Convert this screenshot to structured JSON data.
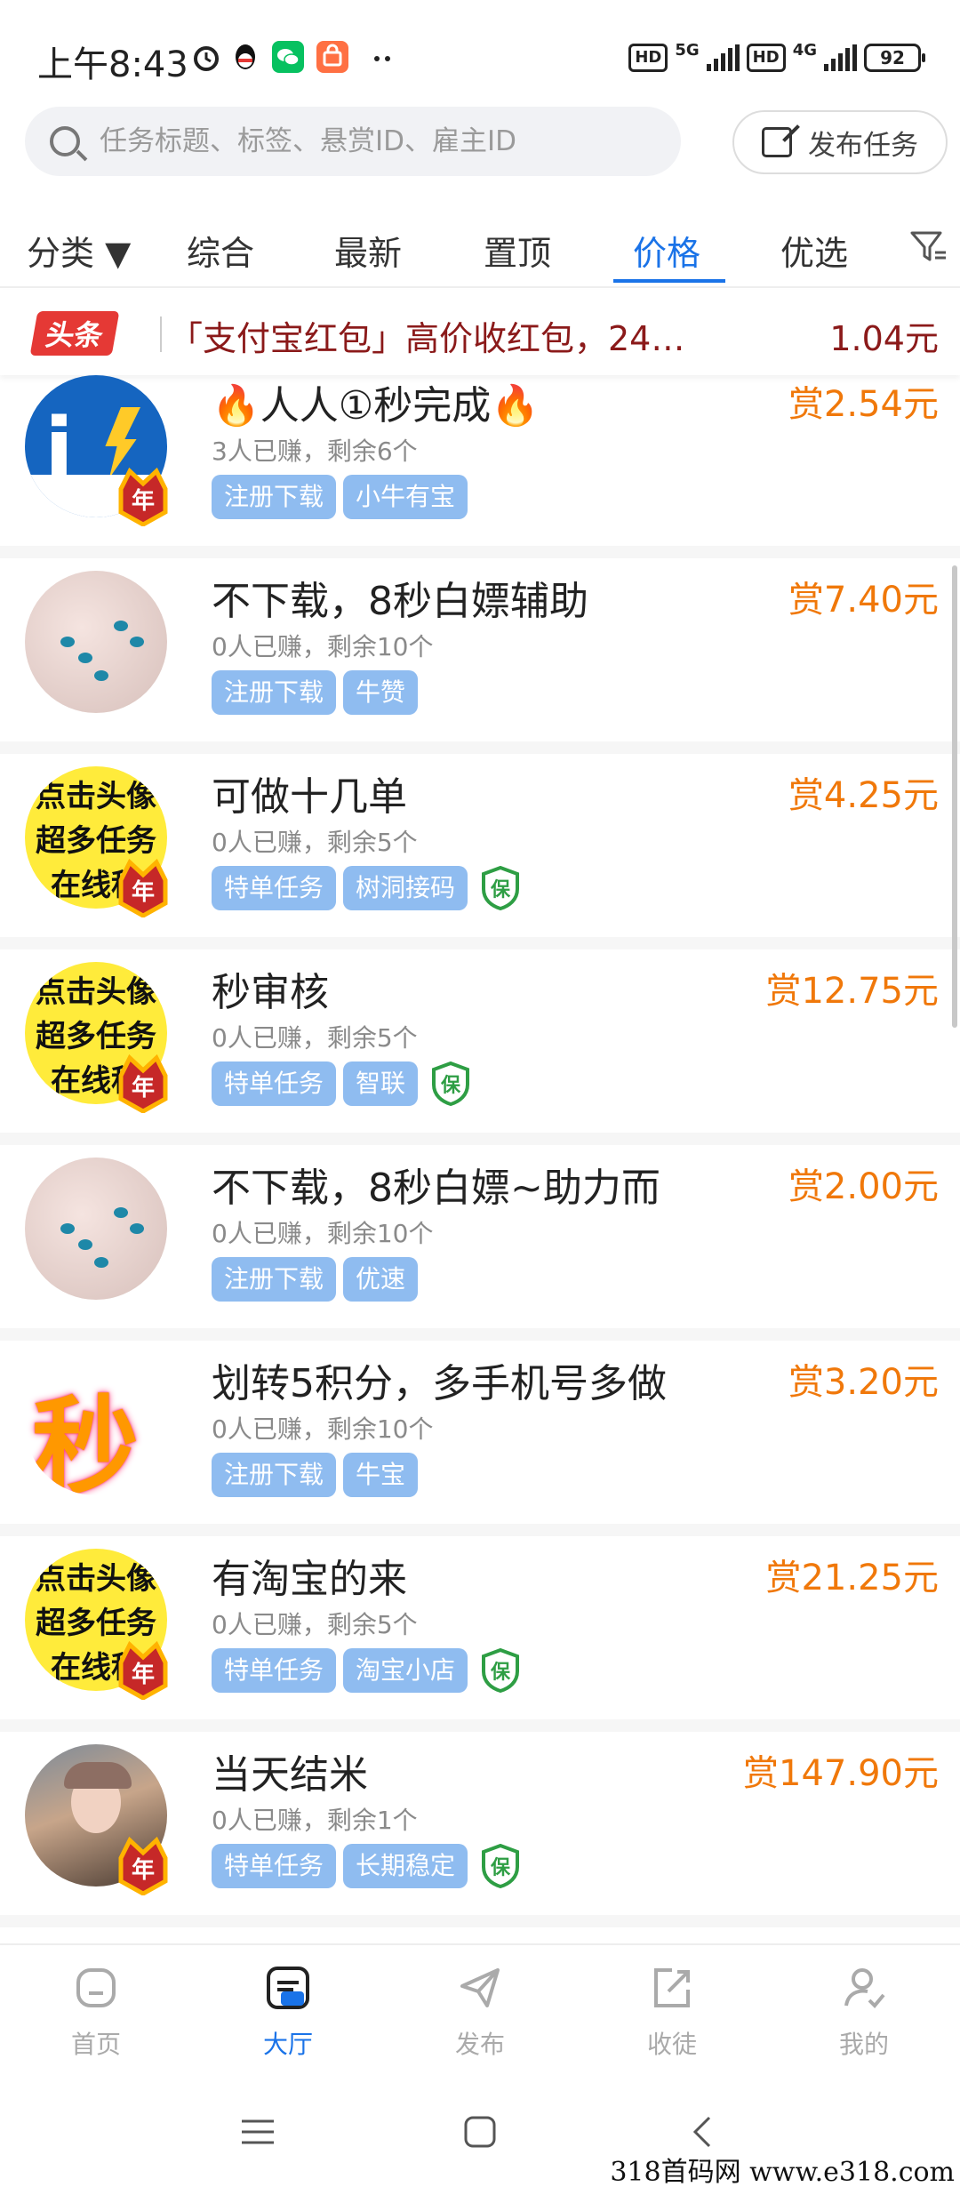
{
  "status_bar": {
    "time": "上午8:43",
    "network1": "5G",
    "network2": "4G",
    "hd": "HD",
    "battery": "92"
  },
  "search": {
    "placeholder": "任务标题、标签、悬赏ID、雇主ID",
    "publish_label": "发布任务"
  },
  "tabs": [
    {
      "label": "分类 ▼"
    },
    {
      "label": "综合"
    },
    {
      "label": "最新"
    },
    {
      "label": "置顶"
    },
    {
      "label": "价格",
      "active": true
    },
    {
      "label": "优选"
    }
  ],
  "headline": {
    "badge": "头条",
    "text": "「支付宝红包」高价收红包，24…",
    "amount": "1.04元"
  },
  "tasks": [
    {
      "title": "🔥人人①秒完成🔥",
      "meta": "3人已赚，剩余6个",
      "tags": [
        "注册下载",
        "小牛有宝"
      ],
      "guarantee": false,
      "reward": "赏2.54元",
      "avatar_text": "",
      "crown_label": "年"
    },
    {
      "title": "不下载，8秒白嫖辅助",
      "meta": "0人已赚，剩余10个",
      "tags": [
        "注册下载",
        "牛赞"
      ],
      "guarantee": false,
      "reward": "赏7.40元",
      "crown_label": ""
    },
    {
      "title": "可做十几单",
      "meta": "0人已赚，剩余5个",
      "tags": [
        "特单任务",
        "树洞接码"
      ],
      "guarantee": true,
      "reward": "赏4.25元",
      "avatar_lines": [
        "点击头像",
        "超多任务",
        "在线秒"
      ],
      "crown_label": "年"
    },
    {
      "title": "秒审核",
      "meta": "0人已赚，剩余5个",
      "tags": [
        "特单任务",
        "智联"
      ],
      "guarantee": true,
      "reward": "赏12.75元",
      "avatar_lines": [
        "点击头像",
        "超多任务",
        "在线秒"
      ],
      "crown_label": "年"
    },
    {
      "title": "不下载，8秒白嫖~助力而",
      "meta": "0人已赚，剩余10个",
      "tags": [
        "注册下载",
        "优速"
      ],
      "guarantee": false,
      "reward": "赏2.00元",
      "crown_label": ""
    },
    {
      "title": "划转5积分，多手机号多做",
      "meta": "0人已赚，剩余10个",
      "tags": [
        "注册下载",
        "牛宝"
      ],
      "guarantee": false,
      "reward": "赏3.20元",
      "avatar_text": "秒",
      "crown_label": ""
    },
    {
      "title": "有淘宝的来",
      "meta": "0人已赚，剩余5个",
      "tags": [
        "特单任务",
        "淘宝小店"
      ],
      "guarantee": true,
      "reward": "赏21.25元",
      "avatar_lines": [
        "点击头像",
        "超多任务",
        "在线秒"
      ],
      "crown_label": "年"
    },
    {
      "title": "当天结米",
      "meta": "0人已赚，剩余1个",
      "tags": [
        "特单任务",
        "长期稳定"
      ],
      "guarantee": true,
      "reward": "赏147.90元",
      "crown_label": "年"
    }
  ],
  "guarantee_label": "保",
  "bottom_nav": [
    {
      "label": "首页",
      "icon": "home-icon"
    },
    {
      "label": "大厅",
      "icon": "hall-icon",
      "active": true
    },
    {
      "label": "发布",
      "icon": "send-icon"
    },
    {
      "label": "收徒",
      "icon": "share-icon"
    },
    {
      "label": "我的",
      "icon": "profile-icon"
    }
  ],
  "watermark": "318首码网  www.e318.com",
  "colors": {
    "accent": "#1a73e8",
    "reward": "#f0780a",
    "tag": "#8fbcf0",
    "headline": "#8b1a1a",
    "badge": "#e53935"
  }
}
